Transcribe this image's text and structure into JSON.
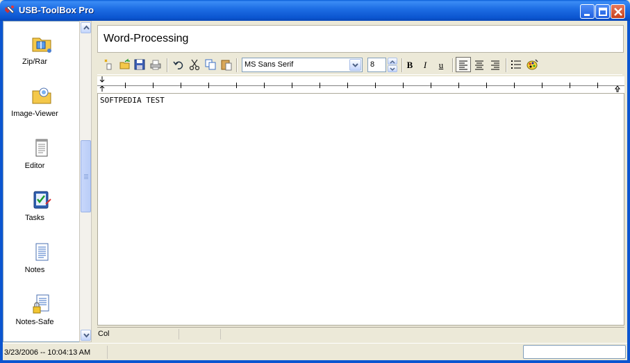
{
  "window": {
    "title": "USB-ToolBox Pro",
    "colors": {
      "titlebar": "#0b55d0",
      "close": "#c8401c"
    }
  },
  "sidebar": {
    "items": [
      {
        "label": "Zip/Rar",
        "icon": "zip-folder-icon"
      },
      {
        "label": "Image-Viewer",
        "icon": "image-folder-icon"
      },
      {
        "label": "Editor",
        "icon": "notepad-icon"
      },
      {
        "label": "Tasks",
        "icon": "tasks-check-icon"
      },
      {
        "label": "Notes",
        "icon": "notes-document-icon"
      },
      {
        "label": "Notes-Safe",
        "icon": "notes-safe-lock-icon"
      }
    ]
  },
  "main": {
    "header_title": "Word-Processing",
    "toolbar": {
      "font_name": "MS Sans Serif",
      "font_size": "8",
      "bold": "B",
      "italic": "I",
      "underline": "u",
      "icons": [
        "new-icon",
        "open-icon",
        "save-icon",
        "print-icon",
        "undo-icon",
        "cut-icon",
        "copy-icon",
        "paste-icon",
        "align-left-icon",
        "align-center-icon",
        "align-right-icon",
        "bullets-icon",
        "color-palette-icon"
      ]
    },
    "document_text": "SOFTPEDIA TEST",
    "status": {
      "col_label": "Col"
    }
  },
  "statusbar": {
    "datetime": "3/23/2006 -- 10:04:13 AM"
  }
}
